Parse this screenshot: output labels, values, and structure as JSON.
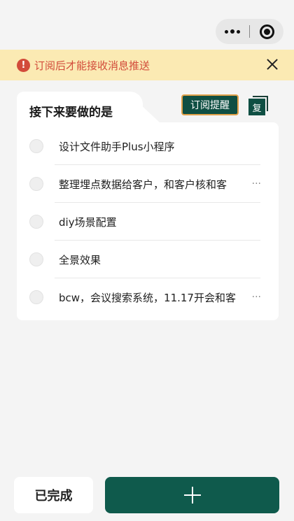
{
  "capsule": {
    "more_icon": "more-dots-icon",
    "target_icon": "target-icon"
  },
  "notice": {
    "text": "订阅后才能接收消息推送",
    "warn_glyph": "!",
    "close_icon": "close-icon",
    "color": "#d24b3a",
    "background": "#fbeab3"
  },
  "header": {
    "title": "接下来要做的是",
    "subscribe_label": "订阅提醒",
    "copy_label": "复"
  },
  "todos": [
    {
      "text": "设计文件助手Plus小程序",
      "truncated": ""
    },
    {
      "text": "整理埋点数据给客户，和客户核和客",
      "truncated": "···"
    },
    {
      "text": "diy场景配置",
      "truncated": ""
    },
    {
      "text": "全景效果",
      "truncated": ""
    },
    {
      "text": "bcw，会议搜索系统，11.17开会和客",
      "truncated": "···"
    }
  ],
  "footer": {
    "done_label": "已完成",
    "add_icon": "plus-icon"
  },
  "colors": {
    "primary": "#0f5a4c",
    "accent_border": "#e1a14a"
  }
}
